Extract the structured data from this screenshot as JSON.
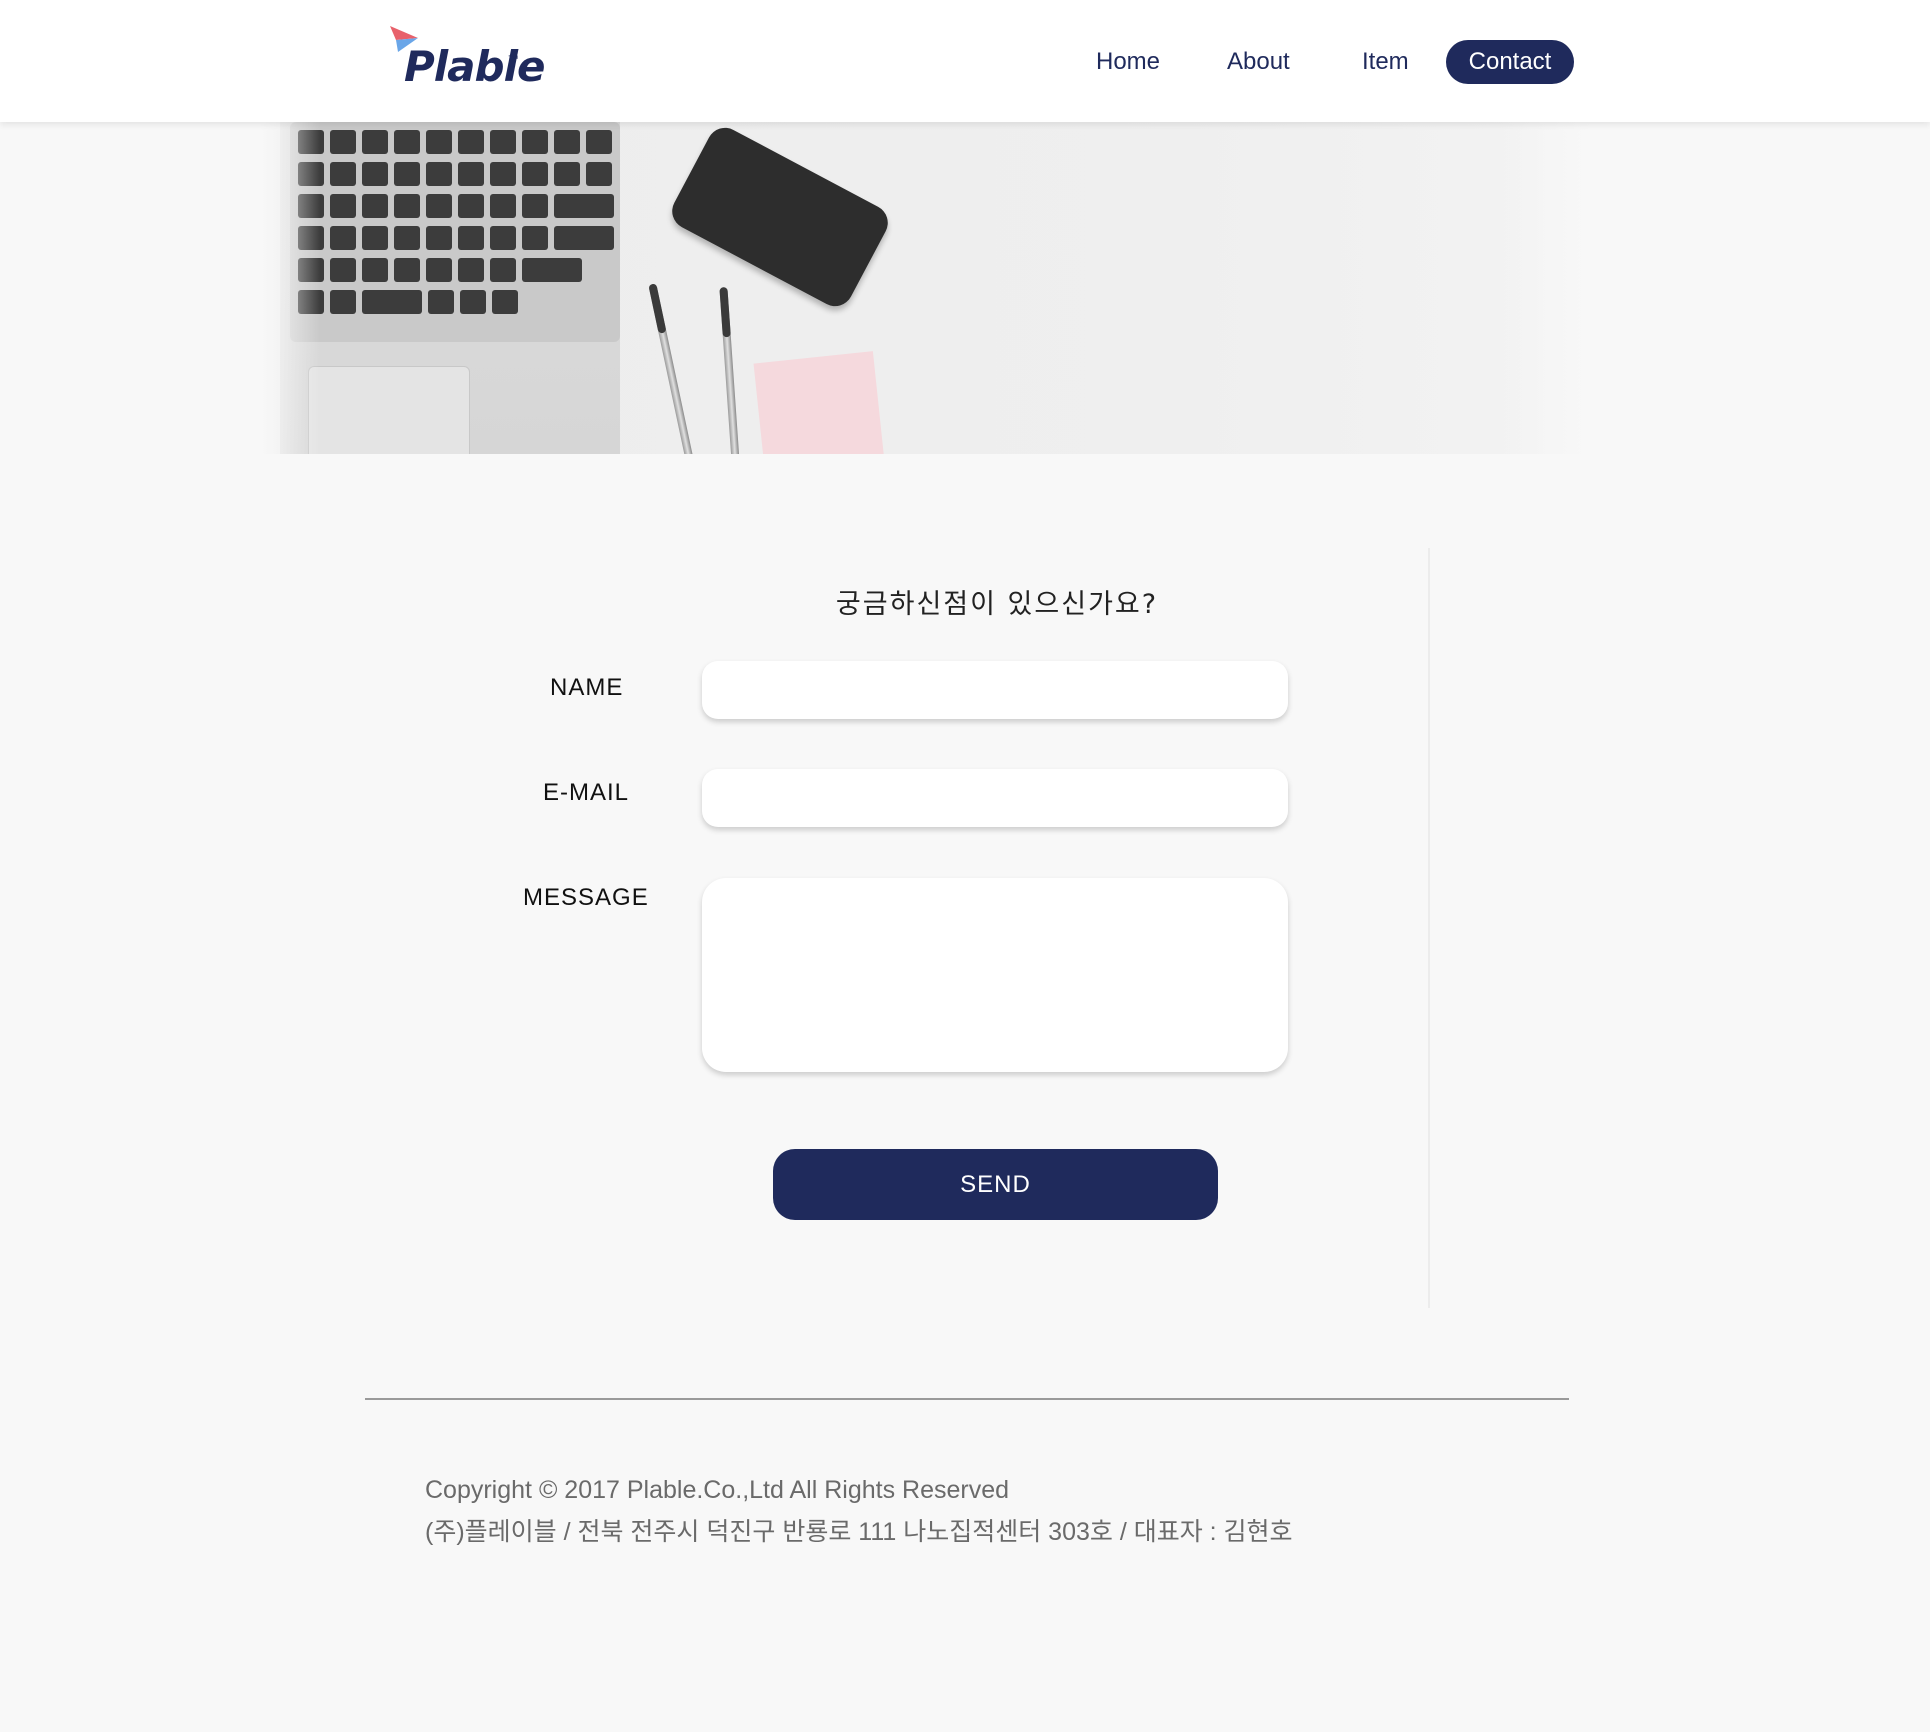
{
  "header": {
    "logo_text": "Plable",
    "logo_tm": "™",
    "nav": {
      "home": "Home",
      "about": "About",
      "item": "Item",
      "contact": "Contact"
    }
  },
  "form": {
    "title": "궁금하신점이 있으신가요?",
    "name_label": "NAME",
    "email_label": "E-MAIL",
    "message_label": "MESSAGE",
    "name_value": "",
    "email_value": "",
    "message_value": "",
    "send_label": "SEND"
  },
  "footer": {
    "copyright": "Copyright © 2017 Plable.Co.,Ltd All Rights Reserved",
    "address": "(주)플레이블 / 전북 전주시 덕진구 반룡로 111 나노집적센터 303호 / 대표자 : 김현호"
  },
  "colors": {
    "brand_navy": "#1f2a5c",
    "logo_accent_red": "#e8616b",
    "logo_accent_blue": "#6aa6e8",
    "background": "#f8f8f8"
  }
}
